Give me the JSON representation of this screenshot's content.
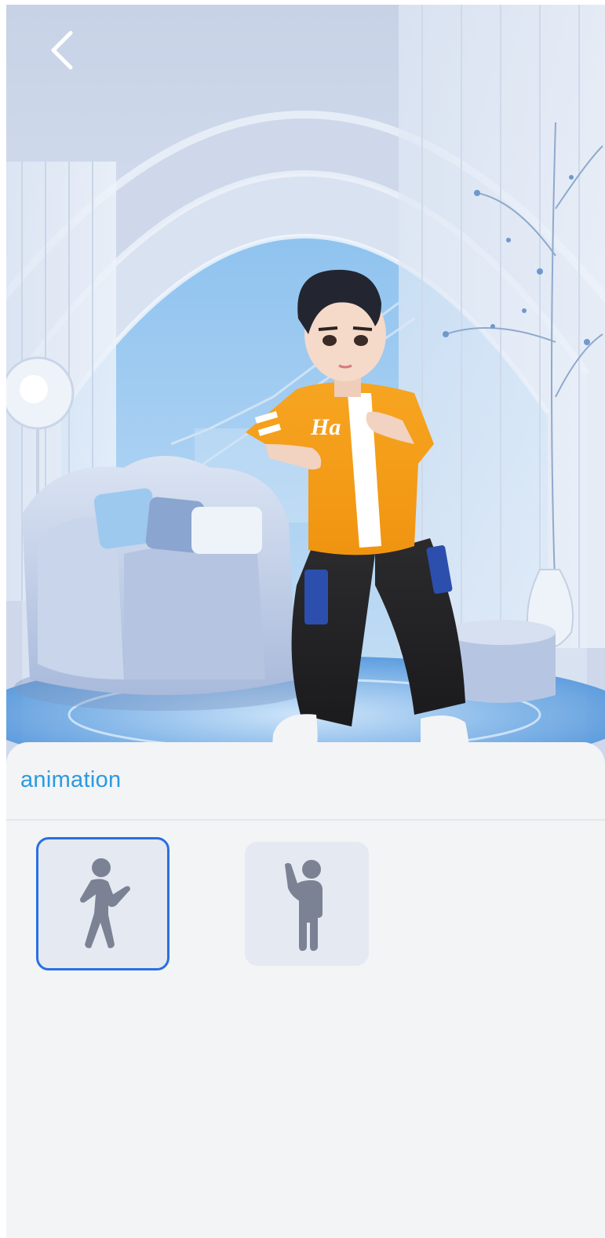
{
  "header": {
    "back_icon": "chevron-left-icon"
  },
  "panel": {
    "title": "animation",
    "accent_color": "#2a9ae0",
    "selected_border_color": "#2a6fe0",
    "tiles": [
      {
        "icon": "dance-pose-icon",
        "selected": true
      },
      {
        "icon": "wave-pose-icon",
        "selected": false
      }
    ]
  }
}
